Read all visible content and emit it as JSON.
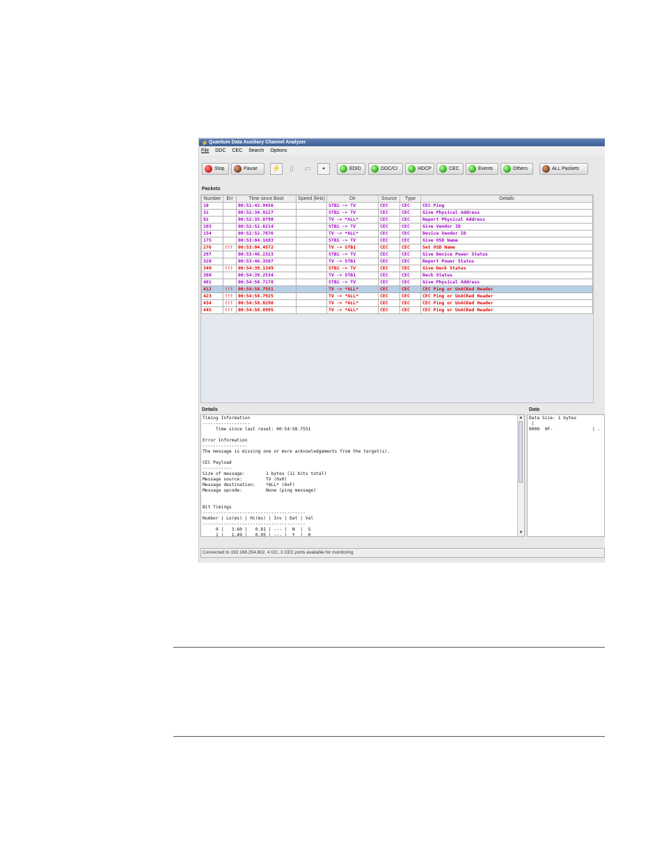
{
  "window": {
    "title": "Quantum Data Auxiliary Channel Analyzer",
    "icon": "lightning-app-icon"
  },
  "menu": [
    "File",
    "DDC",
    "CEC",
    "Search",
    "Options"
  ],
  "toolbar": {
    "stop_label": "Stop",
    "pause_label": "Pause",
    "edid_label": "EDID",
    "ddcci_label": "DDC/CI",
    "hdcp_label": "HDCP",
    "cec_label": "CEC",
    "events_label": "Events",
    "others_label": "Others",
    "all_packets_label": "ALL Packets"
  },
  "packets": {
    "section_title": "Packets",
    "columns": [
      "Number",
      "Err",
      "Time since Boot",
      "Speed (kHz)",
      "Dir",
      "Source",
      "Type",
      "Details"
    ],
    "rows": [
      {
        "number": "10",
        "err": "",
        "time": "00:51:43.9456",
        "speed": "",
        "dir": "STB1 -> TV",
        "source": "CEC",
        "type": "CEC",
        "details": "CEC Ping",
        "status": "normal"
      },
      {
        "number": "31",
        "err": "",
        "time": "00:52:34.9127",
        "speed": "",
        "dir": "STB1 -> TV",
        "source": "CEC",
        "type": "CEC",
        "details": "Give Physical Address",
        "status": "normal"
      },
      {
        "number": "82",
        "err": "",
        "time": "00:52:35.0790",
        "speed": "",
        "dir": "TV -> *ALL*",
        "source": "CEC",
        "type": "CEC",
        "details": "Report Physical Address",
        "status": "normal"
      },
      {
        "number": "103",
        "err": "",
        "time": "00:52:52.6214",
        "speed": "",
        "dir": "STB1 -> TV",
        "source": "CEC",
        "type": "CEC",
        "details": "Give Vendor ID",
        "status": "normal"
      },
      {
        "number": "154",
        "err": "",
        "time": "00:52:52.7876",
        "speed": "",
        "dir": "TV -> *ALL*",
        "source": "CEC",
        "type": "CEC",
        "details": "Device Vendor ID",
        "status": "normal"
      },
      {
        "number": "175",
        "err": "",
        "time": "00:53:04.1683",
        "speed": "",
        "dir": "STB1 -> TV",
        "source": "CEC",
        "type": "CEC",
        "details": "Give OSD Name",
        "status": "normal"
      },
      {
        "number": "276",
        "err": "!!!",
        "time": "00:53:04.4572",
        "speed": "",
        "dir": "TV -> STB1",
        "source": "CEC",
        "type": "CEC",
        "details": "Set OSD Name",
        "status": "error"
      },
      {
        "number": "297",
        "err": "",
        "time": "00:53:46.2323",
        "speed": "",
        "dir": "STB1 -> TV",
        "source": "CEC",
        "type": "CEC",
        "details": "Give Device Power Status",
        "status": "normal"
      },
      {
        "number": "328",
        "err": "",
        "time": "00:53:46.3507",
        "speed": "",
        "dir": "TV -> STB1",
        "source": "CEC",
        "type": "CEC",
        "details": "Report Power Status",
        "status": "normal"
      },
      {
        "number": "349",
        "err": "!!!",
        "time": "00:54:39.1349",
        "speed": "",
        "dir": "STB1 -> TV",
        "source": "CEC",
        "type": "CEC",
        "details": "Give Deck Status",
        "status": "error"
      },
      {
        "number": "380",
        "err": "",
        "time": "00:54:39.2534",
        "speed": "",
        "dir": "TV -> STB1",
        "source": "CEC",
        "type": "CEC",
        "details": "Deck Status",
        "status": "normal"
      },
      {
        "number": "401",
        "err": "",
        "time": "00:54:58.7178",
        "speed": "",
        "dir": "STB1 -> TV",
        "source": "CEC",
        "type": "CEC",
        "details": "Give Physical Address",
        "status": "normal"
      },
      {
        "number": "412",
        "err": "!!!",
        "time": "00:54:58.7551",
        "speed": "",
        "dir": "TV -> *ALL*",
        "source": "CEC",
        "type": "CEC",
        "details": "CEC Ping or UnACKed Header",
        "status": "error",
        "selected": true
      },
      {
        "number": "423",
        "err": "!!!",
        "time": "00:54:58.7925",
        "speed": "",
        "dir": "TV -> *ALL*",
        "source": "CEC",
        "type": "CEC",
        "details": "CEC Ping or UnACKed Header",
        "status": "error"
      },
      {
        "number": "434",
        "err": "!!!",
        "time": "00:54:58.8298",
        "speed": "",
        "dir": "TV -> *ALL*",
        "source": "CEC",
        "type": "CEC",
        "details": "CEC Ping or UnACKed Header",
        "status": "error"
      },
      {
        "number": "445",
        "err": "!!!",
        "time": "00:54:58.8995",
        "speed": "",
        "dir": "TV -> *ALL*",
        "source": "CEC",
        "type": "CEC",
        "details": "CEC Ping or UnACKed Header",
        "status": "error"
      }
    ]
  },
  "details": {
    "section_title": "Details",
    "text": "Timing Information\n------------------\n     Time since last reset: 00:54:58.7551\n\nError Information\n-----------------\nThe message is missing one or more acknowledgements from the target(s).\n\nCEC Payload\n-----------\nSize of message:        1 bytes (11 bits total)\nMessage source:         TV (0x0)\nMessage destination:    *ALL* (0xF)\nMessage opcode:         None (ping message)\n\n\nBit Timings\n---------------------------------------\nNumber | Lo(ms) | Hi(ms) | Inv | Dat | Val\n---------------------------------------\n     0 |   3.60 |   0.81 | --- |  N  |  S\n     1 |   1.49 |   0.95 | --- |  Y  |  0"
  },
  "data": {
    "section_title": "Data",
    "text": "Data Size: 1 bytes\n |\n0000  0F-               | ."
  },
  "status": {
    "text": "Connected to 192.168.254.802. 4 I2C, 3 CEC ports available for monitoring"
  },
  "colors": {
    "normal_row_text": "#a000c8",
    "error_row_text": "#e00000",
    "selected_row_bg": "#b8cfe8",
    "titlebar": "#4a6ea6"
  }
}
